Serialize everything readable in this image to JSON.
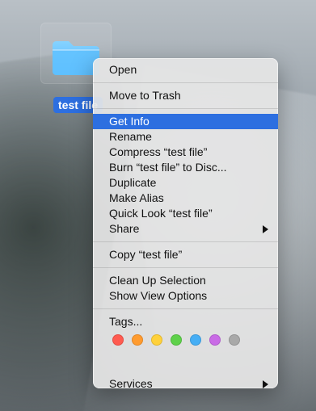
{
  "desktop": {
    "icon_label": "test file"
  },
  "context_menu": {
    "items": {
      "open": "Open",
      "move_to_trash": "Move to Trash",
      "get_info": "Get Info",
      "rename": "Rename",
      "compress": "Compress “test file”",
      "burn": "Burn “test file” to Disc...",
      "duplicate": "Duplicate",
      "make_alias": "Make Alias",
      "quick_look": "Quick Look “test file”",
      "share": "Share",
      "copy": "Copy “test file”",
      "clean_up_selection": "Clean Up Selection",
      "show_view_options": "Show View Options",
      "tags": "Tags...",
      "services": "Services"
    },
    "tag_colors": [
      "#ff5b50",
      "#ff9b2f",
      "#ffd13b",
      "#5ed14a",
      "#46aef5",
      "#c96be6",
      "#a9a9a9"
    ]
  },
  "colors": {
    "highlight": "#2d6fe0",
    "folder": "#6fc2ff"
  }
}
